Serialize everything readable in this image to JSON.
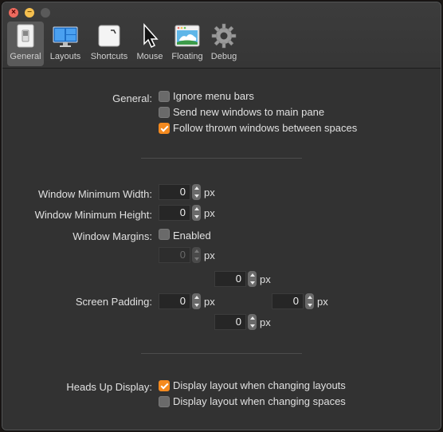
{
  "tabs": [
    {
      "label": "General",
      "icon": "general-switch-icon",
      "selected": true
    },
    {
      "label": "Layouts",
      "icon": "layouts-monitor-icon"
    },
    {
      "label": "Shortcuts",
      "icon": "shortcuts-command-icon"
    },
    {
      "label": "Mouse",
      "icon": "mouse-pointer-icon"
    },
    {
      "label": "Floating",
      "icon": "floating-window-icon"
    },
    {
      "label": "Debug",
      "icon": "debug-gear-icon"
    }
  ],
  "general": {
    "label": "General:",
    "options": [
      {
        "label": "Ignore menu bars",
        "checked": false
      },
      {
        "label": "Send new windows to main pane",
        "checked": false
      },
      {
        "label": "Follow thrown windows between spaces",
        "checked": true
      }
    ]
  },
  "window": {
    "min_width_label": "Window Minimum Width:",
    "min_width_value": "0",
    "min_height_label": "Window Minimum Height:",
    "min_height_value": "0",
    "margins_label": "Window Margins:",
    "margins_enabled_label": "Enabled",
    "margins_enabled": false,
    "margins_value": "0",
    "unit": "px"
  },
  "padding": {
    "label": "Screen Padding:",
    "top": "0",
    "left": "0",
    "right": "0",
    "bottom": "0",
    "unit": "px"
  },
  "hud": {
    "label": "Heads Up Display:",
    "options": [
      {
        "label": "Display layout when changing layouts",
        "checked": true
      },
      {
        "label": "Display layout when changing spaces",
        "checked": false
      }
    ]
  },
  "colors": {
    "accent": "#f58a1f",
    "window_bg": "#323232"
  }
}
